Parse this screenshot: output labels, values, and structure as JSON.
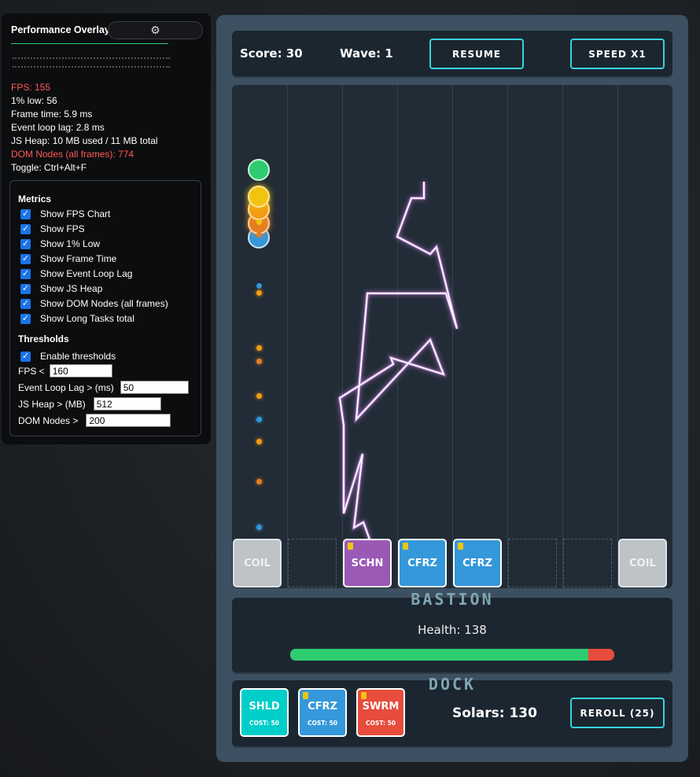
{
  "overlay": {
    "title": "Performance Overlay",
    "fps": "FPS: 155",
    "low": "1% low: 56",
    "frame_time": "Frame time: 5.9 ms",
    "event_lag": "Event loop lag: 2.8 ms",
    "heap": "JS Heap: 10 MB used / 11 MB total",
    "dom": "DOM Nodes (all frames): 774",
    "toggle": "Toggle: Ctrl+Alt+F",
    "metrics_title": "Metrics",
    "metrics": [
      "Show FPS Chart",
      "Show FPS",
      "Show 1% Low",
      "Show Frame Time",
      "Show Event Loop Lag",
      "Show JS Heap",
      "Show DOM Nodes (all frames)",
      "Show Long Tasks total"
    ],
    "thresholds_title": "Thresholds",
    "enable_thresholds": "Enable thresholds",
    "fps_label": "FPS <",
    "fps_value": "160",
    "lag_label": "Event Loop Lag > (ms)",
    "lag_value": "50",
    "heap_label": "JS Heap > (MB)",
    "heap_value": "512",
    "dom_label": "DOM Nodes >",
    "dom_value": "200",
    "warn_color": "#ff5a5a"
  },
  "game": {
    "score": "Score: 30",
    "wave": "Wave: 1",
    "resume": "RESUME",
    "speed": "SPEED X1",
    "slots": [
      {
        "label": "COIL",
        "type": "coil",
        "color": "#bdc3c7",
        "tag": false
      },
      {
        "label": "",
        "type": "empty",
        "color": "",
        "tag": false
      },
      {
        "label": "SCHN",
        "type": "tower",
        "color": "#9b59b6",
        "tag": true
      },
      {
        "label": "CFRZ",
        "type": "tower",
        "color": "#3498db",
        "tag": true
      },
      {
        "label": "CFRZ",
        "type": "tower",
        "color": "#3498db",
        "tag": true
      },
      {
        "label": "",
        "type": "empty",
        "color": "",
        "tag": false
      },
      {
        "label": "",
        "type": "empty",
        "color": "",
        "tag": false
      },
      {
        "label": "COIL",
        "type": "coil",
        "color": "#bdc3c7",
        "tag": false
      }
    ],
    "bastion_title": "BASTION",
    "health": "Health: 138",
    "health_fraction": 0.92,
    "dock_title": "DOCK",
    "dock": [
      {
        "label": "SHLD",
        "cost": "COST: 50",
        "color": "#00cec9",
        "tag": false
      },
      {
        "label": "CFRZ",
        "cost": "COST: 50",
        "color": "#3498db",
        "tag": true
      },
      {
        "label": "SWRM",
        "cost": "COST: 50",
        "color": "#e74c3c",
        "tag": true
      }
    ],
    "solars": "Solars: 130",
    "reroll": "REROLL (25)",
    "accent": "#35d4dd"
  }
}
